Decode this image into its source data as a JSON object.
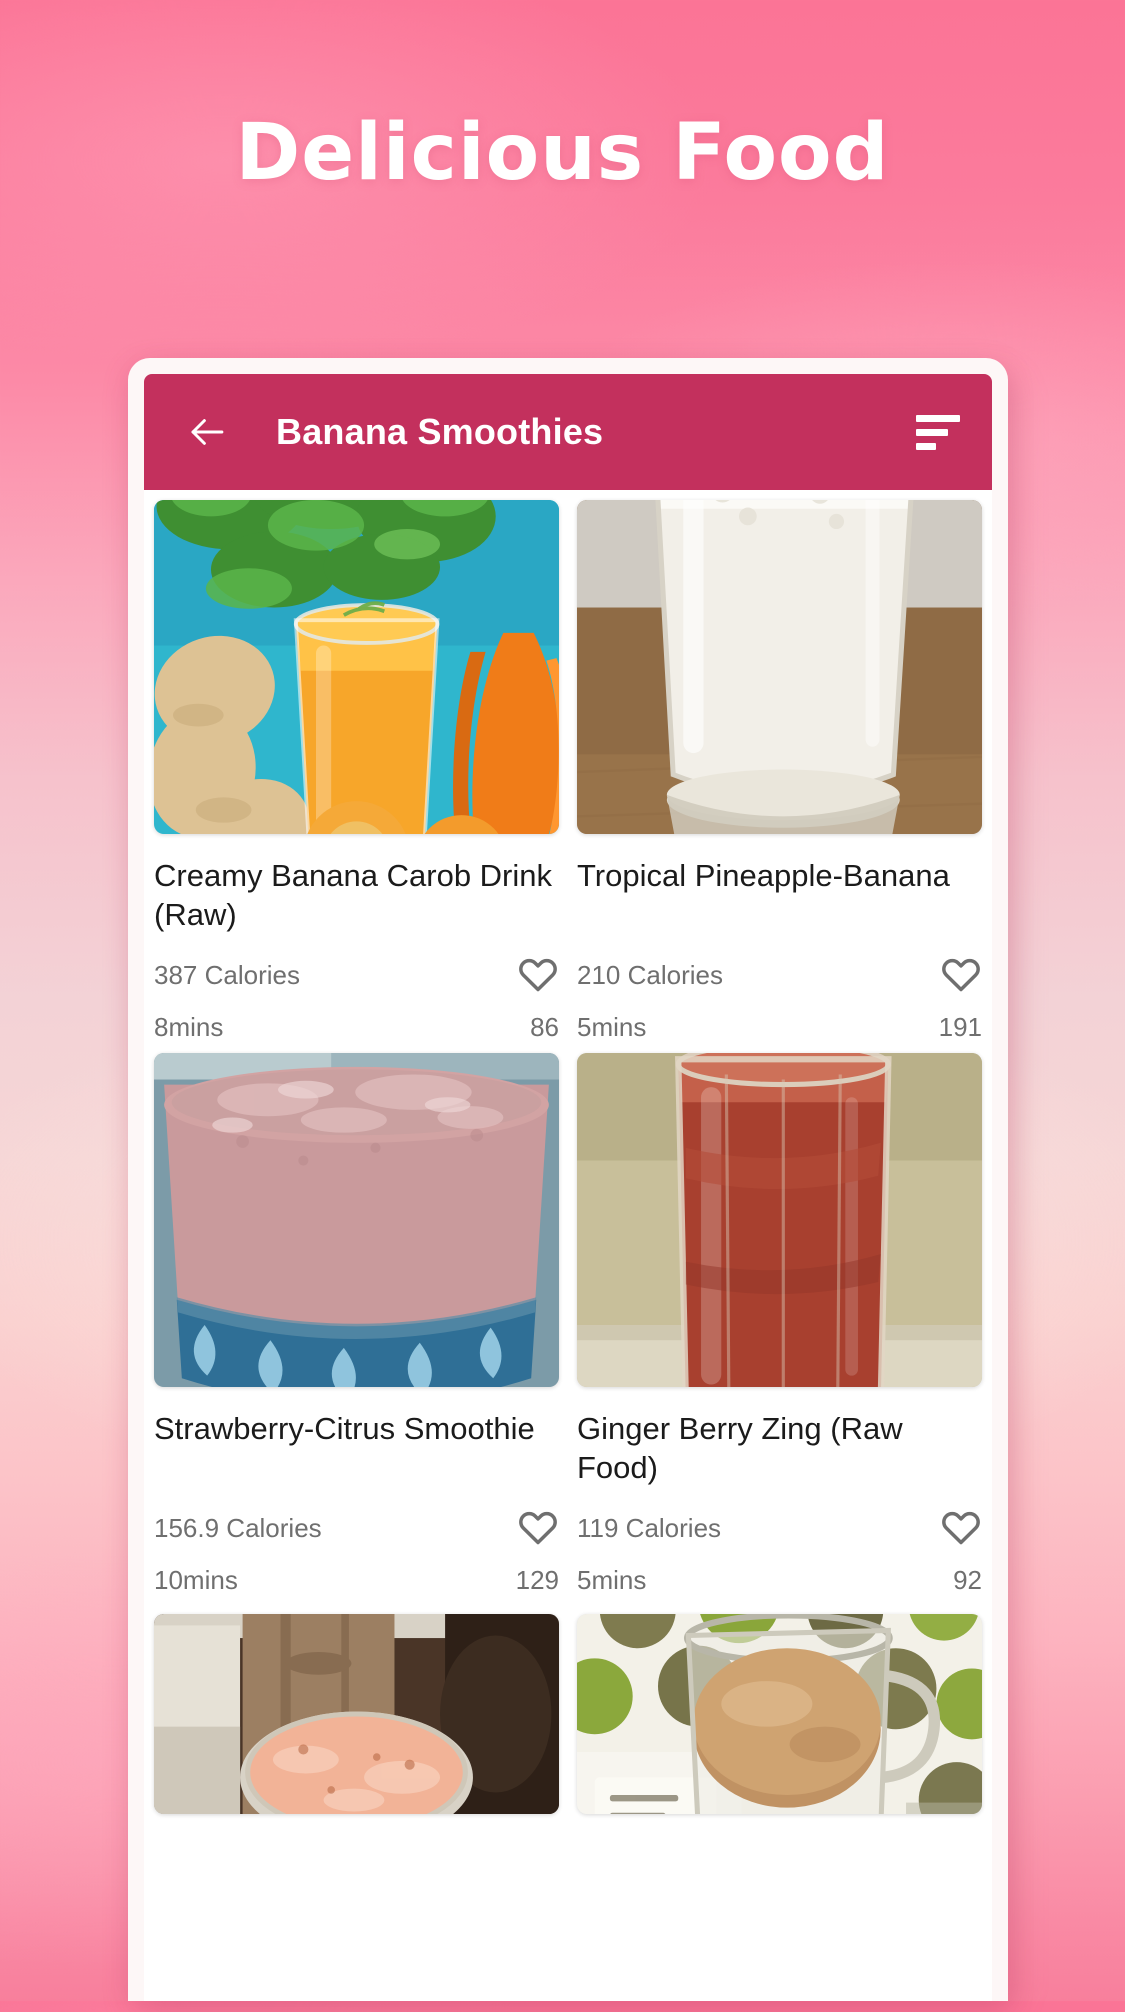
{
  "page": {
    "title": "Delicious Food",
    "background_top_color": "#fb7496",
    "background_mid_color": "#f6d6d6",
    "background_bottom_color": "#f87f9c"
  },
  "appbar": {
    "title": "Banana Smoothies",
    "back_icon": "arrow-left-icon",
    "sort_icon": "sort-icon",
    "background_color": "#c3305d",
    "text_color": "#ffffff"
  },
  "recipes": [
    {
      "name": "Creamy Banana Carob Drink (Raw)",
      "calories": "387 Calories",
      "time": "8mins",
      "likes": "86",
      "favorite_icon": "heart-outline-icon",
      "image": "carrot-ginger-orange-juice-glass"
    },
    {
      "name": "Tropical Pineapple-Banana",
      "calories": "210 Calories",
      "time": "5mins",
      "likes": "191",
      "favorite_icon": "heart-outline-icon",
      "image": "creamy-white-smoothie-tall-glass"
    },
    {
      "name": "Strawberry-Citrus Smoothie",
      "calories": "156.9 Calories",
      "time": "10mins",
      "likes": "129",
      "favorite_icon": "heart-outline-icon",
      "image": "pink-strawberry-smoothie-bowl-glass"
    },
    {
      "name": "Ginger Berry Zing (Raw Food)",
      "calories": "119 Calories",
      "time": "5mins",
      "likes": "92",
      "favorite_icon": "heart-outline-icon",
      "image": "red-berry-smoothie-tall-glass"
    },
    {
      "name": "",
      "calories": "",
      "time": "",
      "likes": "",
      "favorite_icon": "heart-outline-icon",
      "image": "peach-smoothie-wooden-background"
    },
    {
      "name": "",
      "calories": "",
      "time": "",
      "likes": "",
      "favorite_icon": "heart-outline-icon",
      "image": "tan-smoothie-polka-dot-background"
    }
  ]
}
